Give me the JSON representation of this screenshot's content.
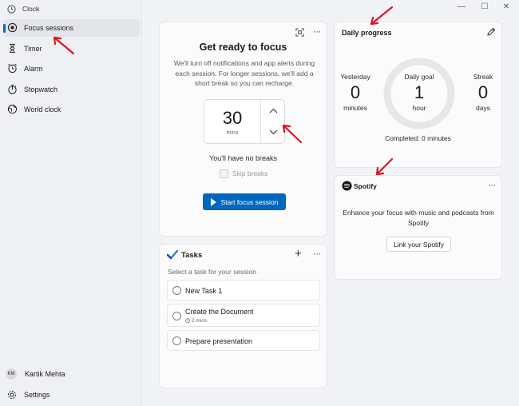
{
  "app": {
    "title": "Clock",
    "window_controls": {
      "minimize": "—",
      "maximize": "☐",
      "close": "✕"
    }
  },
  "sidebar": {
    "items": [
      {
        "label": "Focus sessions",
        "icon": "focus-icon",
        "active": true
      },
      {
        "label": "Timer",
        "icon": "hourglass-icon",
        "active": false
      },
      {
        "label": "Alarm",
        "icon": "alarm-icon",
        "active": false
      },
      {
        "label": "Stopwatch",
        "icon": "stopwatch-icon",
        "active": false
      },
      {
        "label": "World clock",
        "icon": "globe-icon",
        "active": false
      }
    ],
    "user": {
      "initials": "KM",
      "name": "Kartik Mehta"
    },
    "settings_label": "Settings"
  },
  "focus": {
    "title": "Get ready to focus",
    "description": "We'll turn off notifications and app alerts during each session. For longer sessions, we'll add a short break so you can recharge.",
    "minutes": "30",
    "unit": "mins",
    "breaks_text": "You'll have no breaks",
    "skip_breaks_label": "Skip breaks",
    "start_label": "Start focus session"
  },
  "tasks": {
    "title": "Tasks",
    "add": "+",
    "hint": "Select a task for your session",
    "items": [
      {
        "label": "New Task 1",
        "meta": ""
      },
      {
        "label": "Create the Document",
        "meta": "2 mins"
      },
      {
        "label": "Prepare presentation",
        "meta": ""
      }
    ]
  },
  "daily_progress": {
    "title": "Daily progress",
    "yesterday_label": "Yesterday",
    "yesterday_value": "0",
    "yesterday_unit": "minutes",
    "goal_label": "Daily goal",
    "goal_value": "1",
    "goal_unit": "hour",
    "streak_label": "Streak",
    "streak_value": "0",
    "streak_unit": "days",
    "completed_text": "Completed: 0 minutes"
  },
  "spotify": {
    "name": "Spotify",
    "description": "Enhance your focus with music and podcasts from Spotify",
    "link_label": "Link your Spotify"
  },
  "colors": {
    "accent": "#0067c0",
    "annotation_arrow": "#e0141e",
    "spotify": "#111111"
  },
  "more_menu": "···"
}
